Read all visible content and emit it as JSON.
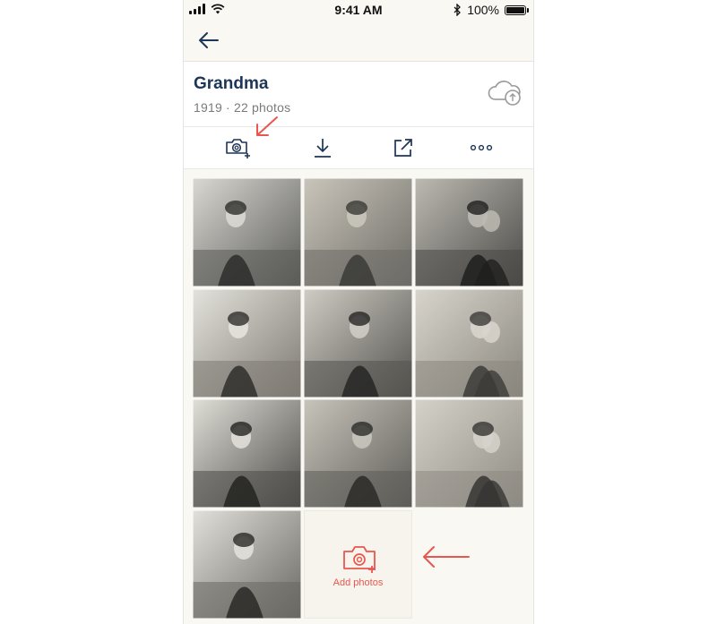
{
  "status_bar": {
    "time": "9:41 AM",
    "battery": "100%"
  },
  "nav": {
    "back_icon": "arrow-left-icon"
  },
  "album": {
    "title": "Grandma",
    "subtitle": "1919 · 22 photos"
  },
  "toolbar": {
    "actions": [
      {
        "name": "add-photo",
        "icon": "camera-plus-icon"
      },
      {
        "name": "download",
        "icon": "download-icon"
      },
      {
        "name": "share",
        "icon": "share-icon"
      },
      {
        "name": "more",
        "icon": "more-icon"
      }
    ]
  },
  "grid": {
    "photos": [
      {
        "name": "photo-1",
        "icon": "photo"
      },
      {
        "name": "photo-2",
        "icon": "photo"
      },
      {
        "name": "photo-3",
        "icon": "photo"
      },
      {
        "name": "photo-4",
        "icon": "photo"
      },
      {
        "name": "photo-5",
        "icon": "photo"
      },
      {
        "name": "photo-6",
        "icon": "photo"
      },
      {
        "name": "photo-7",
        "icon": "photo"
      },
      {
        "name": "photo-8",
        "icon": "photo"
      },
      {
        "name": "photo-9",
        "icon": "photo"
      },
      {
        "name": "photo-10",
        "icon": "photo"
      }
    ],
    "add_label": "Add photos"
  },
  "colors": {
    "title": "#1d3557",
    "accent": "#e8574f",
    "icon": "#1d3557",
    "background": "#f9f8f3"
  }
}
